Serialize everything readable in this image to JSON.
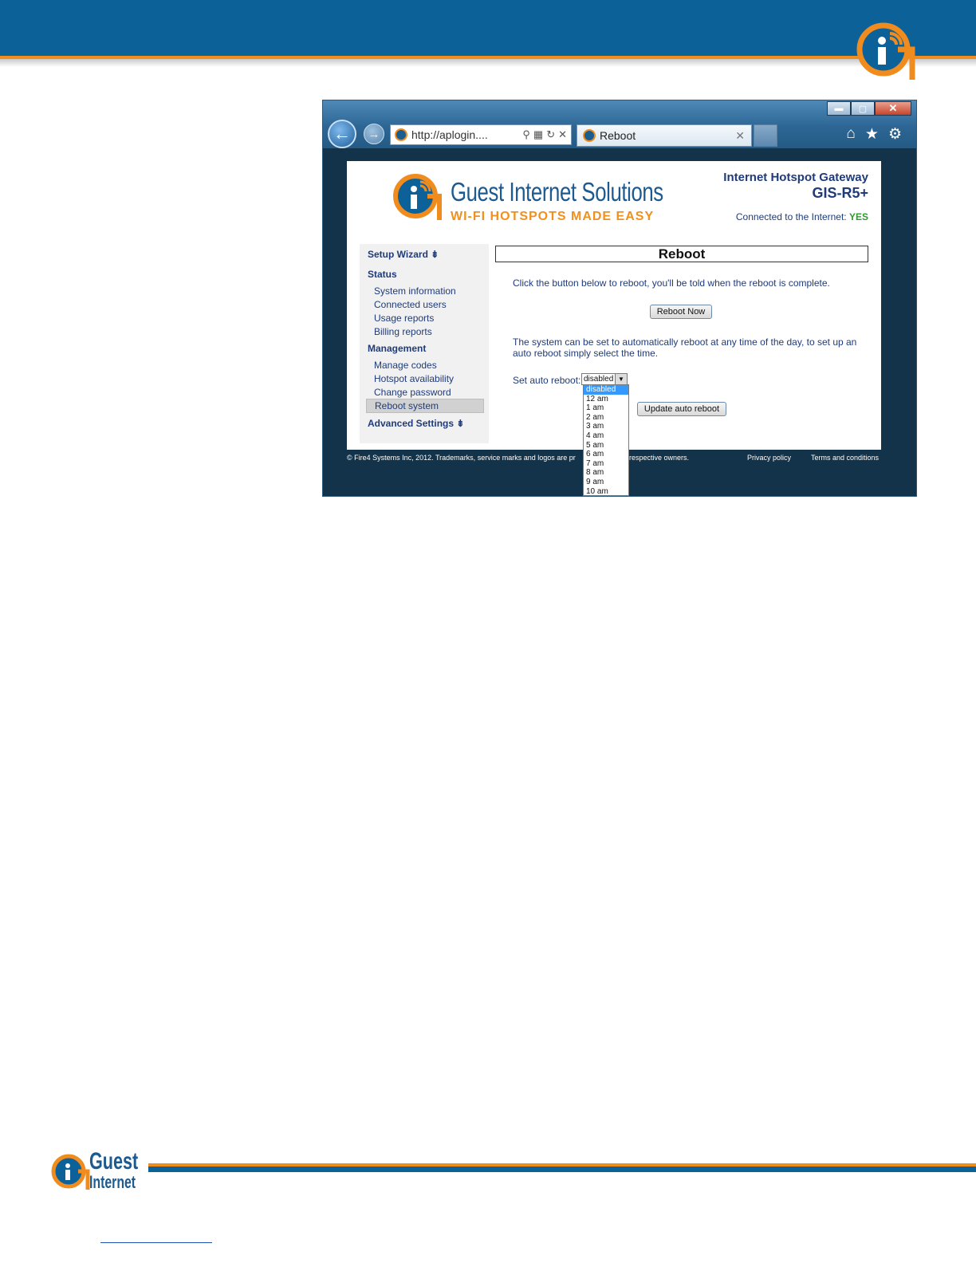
{
  "browser": {
    "url": "http://aplogin....",
    "tab_title": "Reboot"
  },
  "site": {
    "brand_name": "Guest Internet Solutions",
    "tagline": "WI-FI HOTSPOTS MADE EASY",
    "product_title": "Internet Hotspot Gateway",
    "product_model": "GIS-R5+",
    "connection_label": "Connected to the Internet:",
    "connection_value": "YES"
  },
  "sidebar": {
    "setup_wizard": "Setup Wizard",
    "status_heading": "Status",
    "status_items": [
      "System information",
      "Connected users",
      "Usage reports",
      "Billing reports"
    ],
    "management_heading": "Management",
    "management_items": [
      "Manage codes",
      "Hotspot availability",
      "Change password",
      "Reboot system"
    ],
    "active_item": "Reboot system",
    "advanced_settings": "Advanced Settings"
  },
  "main": {
    "title": "Reboot",
    "instructions": "Click the button below to reboot, you'll be told when the reboot is complete.",
    "reboot_button": "Reboot Now",
    "auto_description": "The system can be set to automatically reboot at any time of the day, to set up an auto reboot simply select the time.",
    "auto_label": "Set auto reboot:",
    "auto_value": "disabled",
    "auto_options": [
      "disabled",
      "12 am",
      "1 am",
      "2 am",
      "3 am",
      "4 am",
      "5 am",
      "6 am",
      "7 am",
      "8 am",
      "9 am",
      "10 am"
    ],
    "update_button": "Update auto reboot"
  },
  "footer": {
    "copyright": "© Fire4 Systems Inc, 2012. Trademarks, service marks and logos are pr",
    "copyright_tail": "respective owners.",
    "privacy": "Privacy policy",
    "terms": "Terms and conditions"
  },
  "doc_footer": {
    "brand_top": "Guest",
    "brand_bottom": "Internet"
  },
  "colors": {
    "brand_blue": "#0d6199",
    "brand_orange": "#f08c1e",
    "text_navy": "#1f3b7a",
    "status_green": "#2d9b2d"
  }
}
